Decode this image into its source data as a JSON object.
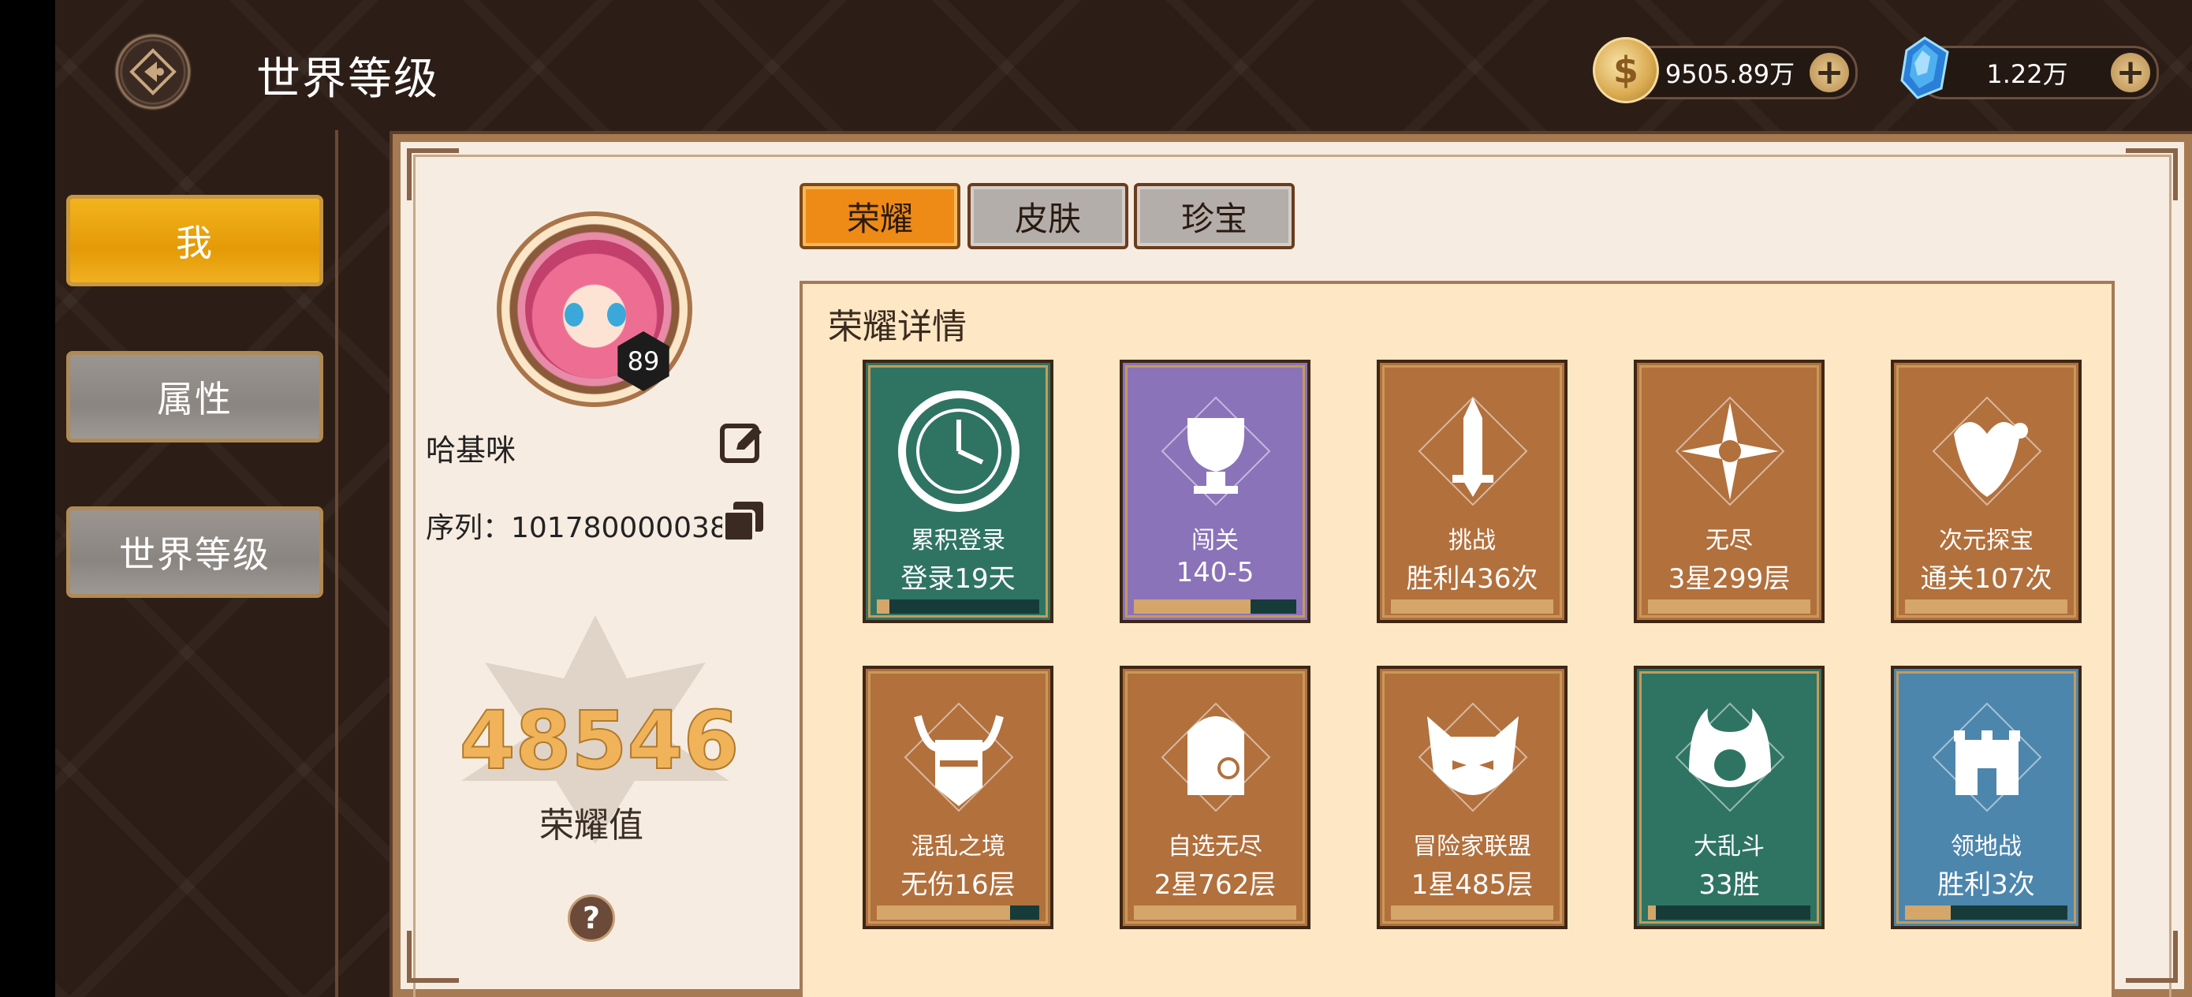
{
  "header": {
    "title": "世界等级",
    "back_icon": "back-diamond-icon",
    "gold": {
      "icon": "coin-icon",
      "value": "9505.89万"
    },
    "gems": {
      "icon": "crystal-icon",
      "value": "1.22万"
    },
    "plus_symbol": "+"
  },
  "sidebar": {
    "items": [
      {
        "label": "我",
        "active": true
      },
      {
        "label": "属性",
        "active": false
      },
      {
        "label": "世界等级",
        "active": false
      }
    ]
  },
  "profile": {
    "level": "89",
    "name": "哈基咪",
    "serial_label": "序列：101780000038",
    "honor_value": "48546",
    "honor_label": "荣耀值",
    "help_symbol": "?"
  },
  "tabs": [
    {
      "label": "荣耀",
      "active": true
    },
    {
      "label": "皮肤",
      "active": false
    },
    {
      "label": "珍宝",
      "active": false
    }
  ],
  "detail": {
    "title": "荣耀详情",
    "cards": [
      {
        "title": "累积登录",
        "value": "登录19天",
        "color": "#2f7463",
        "icon": "clock-icon",
        "progress": 0.08
      },
      {
        "title": "闯关",
        "value": "140-5",
        "color": "#8a73b9",
        "icon": "trophy-icon",
        "progress": 0.72
      },
      {
        "title": "挑战",
        "value": "胜利436次",
        "color": "#b2703d",
        "icon": "sword-icon",
        "progress": 1.0
      },
      {
        "title": "无尽",
        "value": "3星299层",
        "color": "#b2703d",
        "icon": "star-compass-icon",
        "progress": 1.0
      },
      {
        "title": "次元探宝",
        "value": "通关107次",
        "color": "#b2703d",
        "icon": "treasure-icon",
        "progress": 1.0
      },
      {
        "title": "混乱之境",
        "value": "无伤16层",
        "color": "#b2703d",
        "icon": "horned-helmet-icon",
        "progress": 0.82
      },
      {
        "title": "自选无尽",
        "value": "2星762层",
        "color": "#b2703d",
        "icon": "monocle-character-icon",
        "progress": 1.0
      },
      {
        "title": "冒险家联盟",
        "value": "1星485层",
        "color": "#b2703d",
        "icon": "cat-mask-icon",
        "progress": 1.0
      },
      {
        "title": "大乱斗",
        "value": "33胜",
        "color": "#2f7463",
        "icon": "flame-shield-icon",
        "progress": 0.05
      },
      {
        "title": "领地战",
        "value": "胜利3次",
        "color": "#4d86ad",
        "icon": "castle-icon",
        "progress": 0.28
      }
    ]
  }
}
